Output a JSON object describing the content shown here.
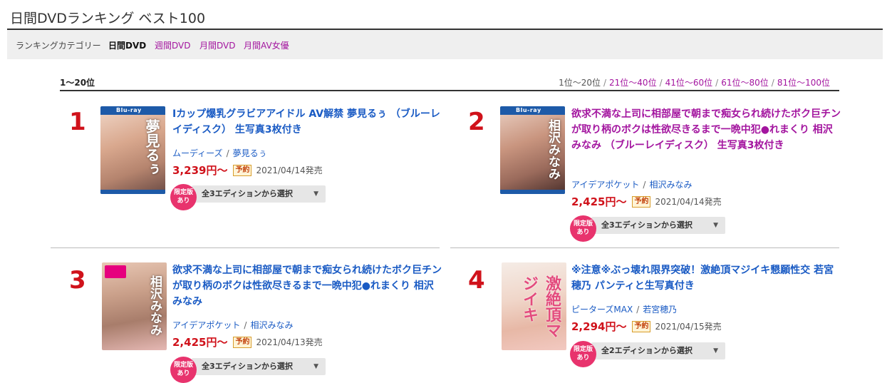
{
  "page": {
    "title": "日間DVDランキング ベスト100"
  },
  "category": {
    "label": "ランキングカテゴリー",
    "active": "日間DVD",
    "links": [
      "週間DVD",
      "月間DVD",
      "月間AV女優"
    ]
  },
  "range": {
    "current": "1〜20位",
    "pager_current": "1位〜20位",
    "pager_links": [
      "21位〜40位",
      "41位〜60位",
      "61位〜80位",
      "81位〜100位"
    ],
    "separator": "/"
  },
  "items": [
    {
      "rank": "1",
      "cover_text": "夢見るぅ",
      "title": "Iカップ爆乳グラビアアイドル AV解禁 夢見るぅ （ブルーレイディスク） 生写真3枚付き",
      "maker": "ムーディーズ",
      "actress": "夢見るぅ",
      "price": "3,239円〜",
      "tag": "予約",
      "date": "2021/04/14発売",
      "limited_badge": "限定版あり",
      "edition": "全3エディションから選択",
      "visited": false
    },
    {
      "rank": "2",
      "cover_text": "相沢みなみ",
      "title": "欲求不満な上司に相部屋で朝まで痴女られ続けたボク巨チンが取り柄のボクは性欲尽きるまで一晩中犯●れまくり 相沢みなみ （ブルーレイディスク） 生写真3枚付き",
      "maker": "アイデアポケット",
      "actress": "相沢みなみ",
      "price": "2,425円〜",
      "tag": "予約",
      "date": "2021/04/14発売",
      "limited_badge": "限定版あり",
      "edition": "全3エディションから選択",
      "visited": true
    },
    {
      "rank": "3",
      "cover_text": "相沢みなみ",
      "title": "欲求不満な上司に相部屋で朝まで痴女られ続けたボク巨チンが取り柄のボクは性欲尽きるまで一晩中犯●れまくり 相沢みなみ",
      "maker": "アイデアポケット",
      "actress": "相沢みなみ",
      "price": "2,425円〜",
      "tag": "予約",
      "date": "2021/04/13発売",
      "limited_badge": "限定版あり",
      "edition": "全3エディションから選択",
      "visited": false
    },
    {
      "rank": "4",
      "cover_text": "激絶頂マジイキ",
      "title": "※注意※ぶっ壊れ限界突破！激絶頂マジイキ懇願性交 若宮穂乃 パンティと生写真付き",
      "maker": "ピーターズMAX",
      "actress": "若宮穂乃",
      "price": "2,294円〜",
      "tag": "予約",
      "date": "2021/04/15発売",
      "limited_badge": "限定版あり",
      "edition": "全2エディションから選択",
      "visited": false
    }
  ],
  "icons": {
    "select_arrow": "chevron-down-icon"
  },
  "colors": {
    "rank": "#d0121b",
    "link": "#1a5bc4",
    "visited": "#a3159f",
    "price": "#d0121b",
    "limited_badge": "#e8336d"
  }
}
